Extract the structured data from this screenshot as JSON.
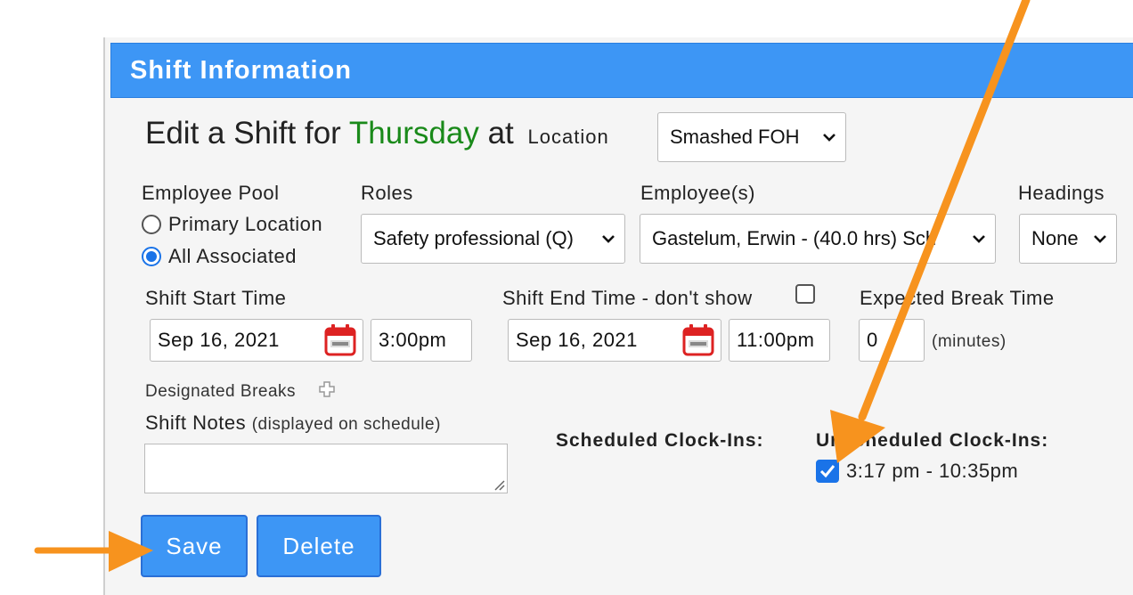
{
  "dialog": {
    "title": "Shift Information",
    "heading_prefix": "Edit a Shift for",
    "heading_day": "Thursday",
    "heading_at": "at",
    "location_label": "Location",
    "location_value": "Smashed FOH"
  },
  "employee_pool": {
    "label": "Employee Pool",
    "options": [
      "Primary Location",
      "All Associated"
    ],
    "selected": "All Associated"
  },
  "roles": {
    "label": "Roles",
    "value": "Safety professional (Q)"
  },
  "employees": {
    "label": "Employee(s)",
    "value": "Gastelum, Erwin - (40.0 hrs) Sch"
  },
  "headings": {
    "label": "Headings",
    "value": "None"
  },
  "shift_start": {
    "label": "Shift Start Time",
    "date": "Sep 16, 2021",
    "time": "3:00pm"
  },
  "shift_end": {
    "label": "Shift End Time - don't show",
    "date": "Sep 16, 2021",
    "time": "11:00pm",
    "dont_show_checked": false
  },
  "break_time": {
    "label": "Expected Break Time",
    "value": "0",
    "unit": "(minutes)"
  },
  "designated_breaks": {
    "label": "Designated Breaks"
  },
  "shift_notes": {
    "label": "Shift Notes",
    "hint": "(displayed on schedule)",
    "value": ""
  },
  "clock_ins": {
    "scheduled_label": "Scheduled Clock-Ins:",
    "unscheduled_label": "Unscheduled Clock-Ins:",
    "unscheduled_entry": "3:17 pm - 10:35pm",
    "unscheduled_checked": true
  },
  "buttons": {
    "save": "Save",
    "delete": "Delete"
  },
  "colors": {
    "title_bar": "#3d96f5",
    "day_green": "#1a8a1a",
    "annotation_arrow": "#f7931e"
  }
}
